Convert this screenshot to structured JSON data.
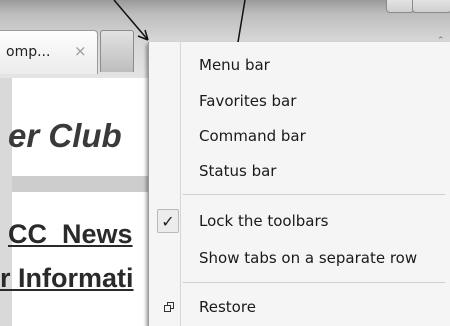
{
  "tab": {
    "title": "omp...",
    "close_glyph": "×"
  },
  "page": {
    "heading": "er Club",
    "link1": "CC_News",
    "link2": "r Informati"
  },
  "menu": {
    "items": [
      {
        "label": "Menu bar",
        "checked": false
      },
      {
        "label": "Favorites bar",
        "checked": false
      },
      {
        "label": "Command bar",
        "checked": false
      },
      {
        "label": "Status bar",
        "checked": false
      },
      {
        "label": "Lock the toolbars",
        "checked": true,
        "mark": "✓"
      },
      {
        "label": "Show tabs on a separate row",
        "checked": false
      },
      {
        "label": "Restore",
        "icon": "restore-window-icon"
      }
    ]
  },
  "colors": {
    "menu_bg": "#f5f5f5",
    "chrome": "#bdbdbd"
  }
}
